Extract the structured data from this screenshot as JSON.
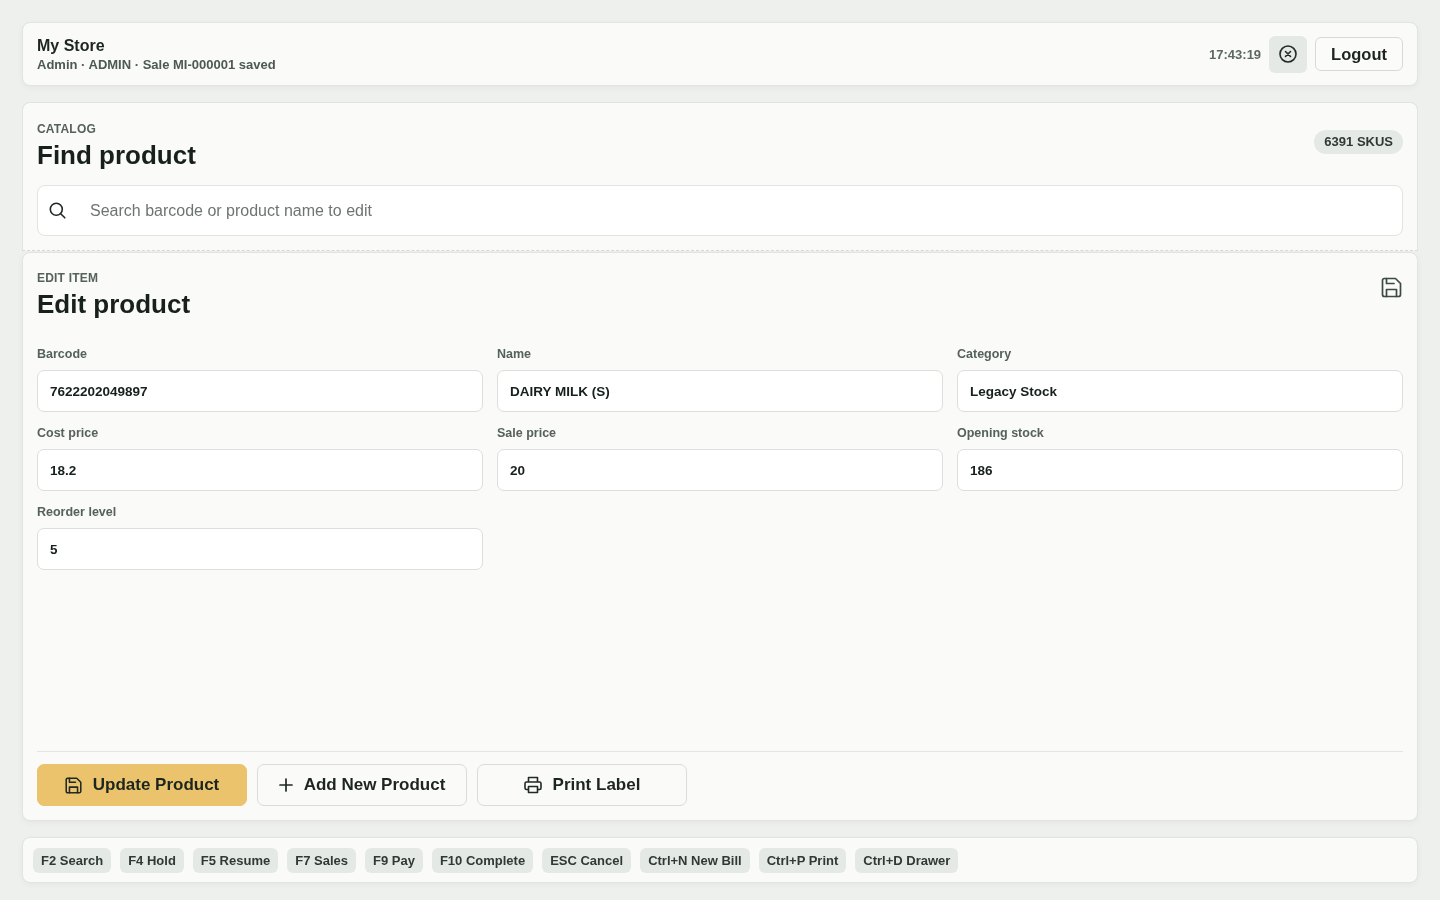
{
  "header": {
    "store_name": "My Store",
    "subtitle": "Admin · ADMIN · Sale MI-000001 saved",
    "time": "17:43:19",
    "logout": "Logout"
  },
  "catalog": {
    "eyebrow": "CATALOG",
    "title": "Find product",
    "sku_count": "6391 SKUS",
    "search": {
      "placeholder": "Search barcode or product name to edit"
    }
  },
  "edit": {
    "eyebrow": "EDIT ITEM",
    "title": "Edit product",
    "fields": [
      {
        "label": "Barcode",
        "value": "7622202049897"
      },
      {
        "label": "Name",
        "value": "DAIRY MILK (S)"
      },
      {
        "label": "Category",
        "value": "Legacy Stock"
      },
      {
        "label": "Cost price",
        "value": "18.2"
      },
      {
        "label": "Sale price",
        "value": "20"
      },
      {
        "label": "Opening stock",
        "value": "186"
      },
      {
        "label": "Reorder level",
        "value": "5"
      }
    ],
    "actions": [
      {
        "label": "Update Product",
        "kind": "update"
      },
      {
        "label": "Add New Product",
        "kind": "add"
      },
      {
        "label": "Print Label",
        "kind": "print"
      }
    ]
  },
  "shortcuts": [
    "F2 Search",
    "F4 Hold",
    "F5 Resume",
    "F7 Sales",
    "F9 Pay",
    "F10 Complete",
    "ESC Cancel",
    "Ctrl+N New Bill",
    "Ctrl+P Print",
    "Ctrl+D Drawer"
  ]
}
